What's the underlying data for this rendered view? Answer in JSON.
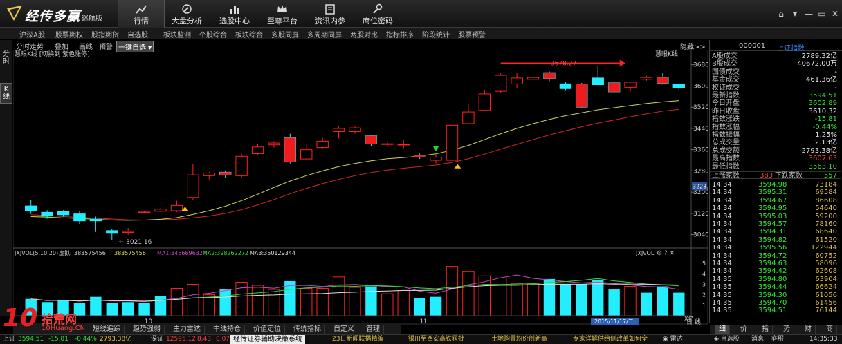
{
  "app": {
    "name": "经传多赢",
    "edition": "巡航版"
  },
  "nav": [
    {
      "label": "行情",
      "icon": "trend-chart-icon",
      "active": true
    },
    {
      "label": "大盘分析",
      "icon": "compass-icon"
    },
    {
      "label": "选股中心",
      "icon": "bar-chart-icon"
    },
    {
      "label": "至尊平台",
      "icon": "crown-icon"
    },
    {
      "label": "资讯内参",
      "icon": "document-icon"
    },
    {
      "label": "席位密码",
      "icon": "key-icon"
    }
  ],
  "menu": [
    "沪深A股",
    "股票期权",
    "股指期货",
    "自选股",
    "板块监测",
    "个股综合",
    "板块综合",
    "多股同屏",
    "多周期同屏",
    "两股对比",
    "指标排序",
    "阶段统计",
    "股票预警"
  ],
  "left_tabs": [
    {
      "label": "分时"
    },
    {
      "label": "K线",
      "active": true
    }
  ],
  "chart_toolbar": {
    "items": [
      "分时走势",
      "叠加",
      "画线",
      "预警"
    ],
    "custom": "一键自选",
    "hide": "隐藏>>"
  },
  "main_chart": {
    "indicator": "慧眼K线 [切换到 紫色涨停]",
    "indicator_right": "慧眼K线",
    "current_price_tag": "3223.23",
    "high_annotation": "3678.27",
    "low_annotation": "3021.16"
  },
  "volume_chart": {
    "name": "JXJVOL(5,10,20)",
    "vir_label": "虚拟:",
    "vir_value": "383575456",
    "vol_value": "383575456",
    "ma1": "MA1:345669632",
    "ma2": "MA2:398262272",
    "ma3": "MA3:350129344",
    "right_name": "JXJVOL",
    "unit": "X亿",
    "x_labels": [
      "10",
      "11"
    ],
    "date_tag": "2015/11/17/二"
  },
  "chart_data": {
    "type": "candlestick",
    "y_ticks": [
      3040,
      3120,
      3200,
      3280,
      3360,
      3440,
      3520,
      3600,
      3680
    ],
    "ylim": [
      3000,
      3700
    ],
    "candles": [
      {
        "o": 3148,
        "c": 3130,
        "h": 3170,
        "l": 3118
      },
      {
        "o": 3124,
        "c": 3110,
        "h": 3132,
        "l": 3100
      },
      {
        "o": 3128,
        "c": 3115,
        "h": 3132,
        "l": 3108
      },
      {
        "o": 3118,
        "c": 3092,
        "h": 3128,
        "l": 3080
      },
      {
        "o": 3098,
        "c": 3092,
        "h": 3108,
        "l": 3050
      },
      {
        "o": 3055,
        "c": 3045,
        "h": 3060,
        "l": 3021
      },
      {
        "o": 3048,
        "c": 3052,
        "h": 3065,
        "l": 3040
      },
      {
        "o": 3125,
        "c": 3125,
        "h": 3130,
        "l": 3120
      },
      {
        "o": 3128,
        "c": 3136,
        "h": 3140,
        "l": 3125
      },
      {
        "o": 3130,
        "c": 3150,
        "h": 3168,
        "l": 3125
      },
      {
        "o": 3180,
        "c": 3265,
        "h": 3305,
        "l": 3172
      },
      {
        "o": 3262,
        "c": 3272,
        "h": 3276,
        "l": 3248
      },
      {
        "o": 3275,
        "c": 3265,
        "h": 3282,
        "l": 3255
      },
      {
        "o": 3262,
        "c": 3335,
        "h": 3345,
        "l": 3255
      },
      {
        "o": 3345,
        "c": 3370,
        "h": 3380,
        "l": 3340
      },
      {
        "o": 3378,
        "c": 3385,
        "h": 3392,
        "l": 3368
      },
      {
        "o": 3405,
        "c": 3315,
        "h": 3420,
        "l": 3308
      },
      {
        "o": 3325,
        "c": 3360,
        "h": 3380,
        "l": 3320
      },
      {
        "o": 3368,
        "c": 3392,
        "h": 3405,
        "l": 3362
      },
      {
        "o": 3428,
        "c": 3440,
        "h": 3448,
        "l": 3402
      },
      {
        "o": 3428,
        "c": 3442,
        "h": 3447,
        "l": 3420
      },
      {
        "o": 3412,
        "c": 3382,
        "h": 3416,
        "l": 3372
      },
      {
        "o": 3380,
        "c": 3382,
        "h": 3392,
        "l": 3370
      },
      {
        "o": 3378,
        "c": 3380,
        "h": 3398,
        "l": 3362
      },
      {
        "o": 3338,
        "c": 3332,
        "h": 3345,
        "l": 3325
      },
      {
        "o": 3320,
        "c": 3332,
        "h": 3342,
        "l": 3308
      },
      {
        "o": 3320,
        "c": 3452,
        "h": 3455,
        "l": 3310
      },
      {
        "o": 3458,
        "c": 3502,
        "h": 3532,
        "l": 3455
      },
      {
        "o": 3508,
        "c": 3570,
        "h": 3585,
        "l": 3504
      },
      {
        "o": 3580,
        "c": 3640,
        "h": 3650,
        "l": 3574
      },
      {
        "o": 3608,
        "c": 3630,
        "h": 3648,
        "l": 3592
      },
      {
        "o": 3625,
        "c": 3632,
        "h": 3652,
        "l": 3618
      },
      {
        "o": 3650,
        "c": 3628,
        "h": 3655,
        "l": 3618
      },
      {
        "o": 3608,
        "c": 3590,
        "h": 3615,
        "l": 3582
      },
      {
        "o": 3607,
        "c": 3520,
        "h": 3612,
        "l": 3518
      },
      {
        "o": 3630,
        "c": 3605,
        "h": 3678,
        "l": 3603
      },
      {
        "o": 3612,
        "c": 3578,
        "h": 3618,
        "l": 3575
      },
      {
        "o": 3595,
        "c": 3614,
        "h": 3615,
        "l": 3580
      },
      {
        "o": 3625,
        "c": 3632,
        "h": 3638,
        "l": 3620
      },
      {
        "o": 3632,
        "c": 3610,
        "h": 3648,
        "l": 3605
      },
      {
        "o": 3605,
        "c": 3594,
        "h": 3610,
        "l": 3585
      }
    ],
    "ma_yellow": [
      3108,
      3106,
      3103,
      3101,
      3098,
      3095,
      3094,
      3095,
      3098,
      3104,
      3116,
      3130,
      3147,
      3168,
      3192,
      3218,
      3242,
      3262,
      3280,
      3296,
      3308,
      3318,
      3326,
      3330,
      3336,
      3344,
      3358,
      3376,
      3398,
      3420,
      3440,
      3458,
      3474,
      3488,
      3499,
      3510,
      3518,
      3526,
      3534,
      3540,
      3545
    ],
    "ma_red": [
      3115,
      3112,
      3108,
      3105,
      3102,
      3099,
      3096,
      3095,
      3096,
      3098,
      3103,
      3110,
      3120,
      3134,
      3152,
      3172,
      3194,
      3214,
      3232,
      3248,
      3262,
      3274,
      3283,
      3290,
      3296,
      3302,
      3312,
      3326,
      3343,
      3362,
      3380,
      3398,
      3415,
      3431,
      3446,
      3460,
      3472,
      3484,
      3495,
      3505,
      3512
    ],
    "volume_ticks": [
      1,
      2,
      3,
      4,
      5
    ],
    "volume_ylim": [
      0,
      5.6
    ],
    "volumes": [
      {
        "v": 1.6,
        "up": false
      },
      {
        "v": 1.3,
        "up": false
      },
      {
        "v": 1.5,
        "up": false
      },
      {
        "v": 1.2,
        "up": false
      },
      {
        "v": 1.8,
        "up": false
      },
      {
        "v": 1.2,
        "up": false
      },
      {
        "v": 1.3,
        "up": false
      },
      {
        "v": 1.2,
        "up": false
      },
      {
        "v": 1.9,
        "up": false
      },
      {
        "v": 2.6,
        "up": true
      },
      {
        "v": 3.0,
        "up": true
      },
      {
        "v": 2.0,
        "up": true
      },
      {
        "v": 2.5,
        "up": false
      },
      {
        "v": 3.2,
        "up": true
      },
      {
        "v": 2.9,
        "up": true
      },
      {
        "v": 2.5,
        "up": true
      },
      {
        "v": 3.3,
        "up": false
      },
      {
        "v": 2.6,
        "up": true
      },
      {
        "v": 2.6,
        "up": true
      },
      {
        "v": 3.7,
        "up": true
      },
      {
        "v": 2.7,
        "up": true
      },
      {
        "v": 2.8,
        "up": false
      },
      {
        "v": 2.1,
        "up": true
      },
      {
        "v": 2.4,
        "up": true
      },
      {
        "v": 1.7,
        "up": false
      },
      {
        "v": 1.8,
        "up": false
      },
      {
        "v": 4.7,
        "up": true
      },
      {
        "v": 4.2,
        "up": true
      },
      {
        "v": 3.8,
        "up": true
      },
      {
        "v": 3.6,
        "up": true
      },
      {
        "v": 3.1,
        "up": true
      },
      {
        "v": 3.1,
        "up": true
      },
      {
        "v": 3.5,
        "up": false
      },
      {
        "v": 3.0,
        "up": false
      },
      {
        "v": 3.0,
        "up": false
      },
      {
        "v": 3.4,
        "up": false
      },
      {
        "v": 2.5,
        "up": false
      },
      {
        "v": 2.8,
        "up": true
      },
      {
        "v": 2.2,
        "up": false
      },
      {
        "v": 2.8,
        "up": false
      },
      {
        "v": 2.2,
        "up": false
      }
    ]
  },
  "index_panel": {
    "code": "000001",
    "name": "上证指数",
    "rows": [
      {
        "label": "A股成交",
        "value": "2789.32亿",
        "color": "#e6e6e6"
      },
      {
        "label": "B股成交",
        "value": "40672.00万",
        "color": "#e6e6e6"
      },
      {
        "label": "国债成交",
        "value": "-",
        "color": "#e6e6e6"
      },
      {
        "label": "基金成交",
        "value": "461.36亿",
        "color": "#e6e6e6"
      },
      {
        "label": "权证成交",
        "value": "-",
        "color": "#e6e6e6"
      },
      {
        "label": "最新指数",
        "value": "3594.51",
        "color": "#2ee82e"
      },
      {
        "label": "今日开盘",
        "value": "3602.89",
        "color": "#2ee82e"
      },
      {
        "label": "昨日收盘",
        "value": "3610.32",
        "color": "#e6e6e6"
      },
      {
        "label": "指数涨跌",
        "value": "-15.81",
        "color": "#2ee82e"
      },
      {
        "label": "指数涨幅",
        "value": "-0.44%",
        "color": "#2ee82e"
      },
      {
        "label": "指数振幅",
        "value": "1.25%",
        "color": "#e6e6e6"
      },
      {
        "label": "总成交量",
        "value": "2.13亿",
        "color": "#e6e6e6"
      },
      {
        "label": "总成交额",
        "value": "2793.38亿",
        "color": "#e6e6e6"
      },
      {
        "label": "最高指数",
        "value": "3607.63",
        "color": "#ff3b3b"
      },
      {
        "label": "最低指数",
        "value": "3563.10",
        "color": "#2ee82e"
      }
    ],
    "breadth": {
      "up_label": "上涨家数",
      "up_count": "383",
      "down_label": "下跌家数",
      "down_count": "557"
    },
    "ticks": [
      {
        "t": "14:34",
        "p": "3594.98",
        "v": "73184"
      },
      {
        "t": "14:34",
        "p": "3595.31",
        "v": "69584"
      },
      {
        "t": "14:34",
        "p": "3594.67",
        "v": "86608"
      },
      {
        "t": "14:34",
        "p": "3594.95",
        "v": "54640"
      },
      {
        "t": "14:34",
        "p": "3595.03",
        "v": "59200"
      },
      {
        "t": "14:34",
        "p": "3594.57",
        "v": "78160"
      },
      {
        "t": "14:34",
        "p": "3594.31",
        "v": "68640"
      },
      {
        "t": "14:34",
        "p": "3594.82",
        "v": "61520"
      },
      {
        "t": "14:34",
        "p": "3595.56",
        "v": "122944"
      },
      {
        "t": "14:34",
        "p": "3594.72",
        "v": "60752"
      },
      {
        "t": "14:34",
        "p": "3594.63",
        "v": "58096"
      },
      {
        "t": "14:34",
        "p": "3594.42",
        "v": "62608"
      },
      {
        "t": "14:35",
        "p": "3594.80",
        "v": "63904"
      },
      {
        "t": "14:35",
        "p": "3594.44",
        "v": "66624"
      },
      {
        "t": "14:35",
        "p": "3594.30",
        "v": "61056"
      },
      {
        "t": "14:35",
        "p": "3594.70",
        "v": "61456"
      },
      {
        "t": "14:35",
        "p": "3594.51",
        "v": "76144"
      }
    ]
  },
  "right_side_labels": {
    "day": "日",
    "line": "线"
  },
  "bottom_tabs": [
    "短线追踪",
    "趋势强弱",
    "主力雷达",
    "中线持仓",
    "价值定位",
    "传统指标",
    "自定义",
    "管理"
  ],
  "right_tabs": [
    "细",
    "价",
    "指",
    "势",
    "财",
    "商"
  ],
  "status": {
    "sh_label": "上证",
    "sh_price": "3594.51",
    "sh_change": "-15.81",
    "sh_pct": "-0.44%",
    "sh_amount": "2793.38亿",
    "sz_label": "深证",
    "sz_price": "12595.12",
    "sz_change": "8.43",
    "sz_pct": "0.07%",
    "banner": "经传证券辅助决策系统",
    "news": [
      "23日新闻联播精编",
      "银川至西安高铁获批",
      "土地购置均价创新高",
      "专家详解供给侧改革如何全"
    ],
    "right_items": [
      "雷达",
      "自选股",
      "消息",
      "客服"
    ],
    "clock": "14:35:33"
  },
  "watermark": {
    "logo": "10",
    "cn": "拾荒网",
    "url": "10Huang.CN"
  }
}
